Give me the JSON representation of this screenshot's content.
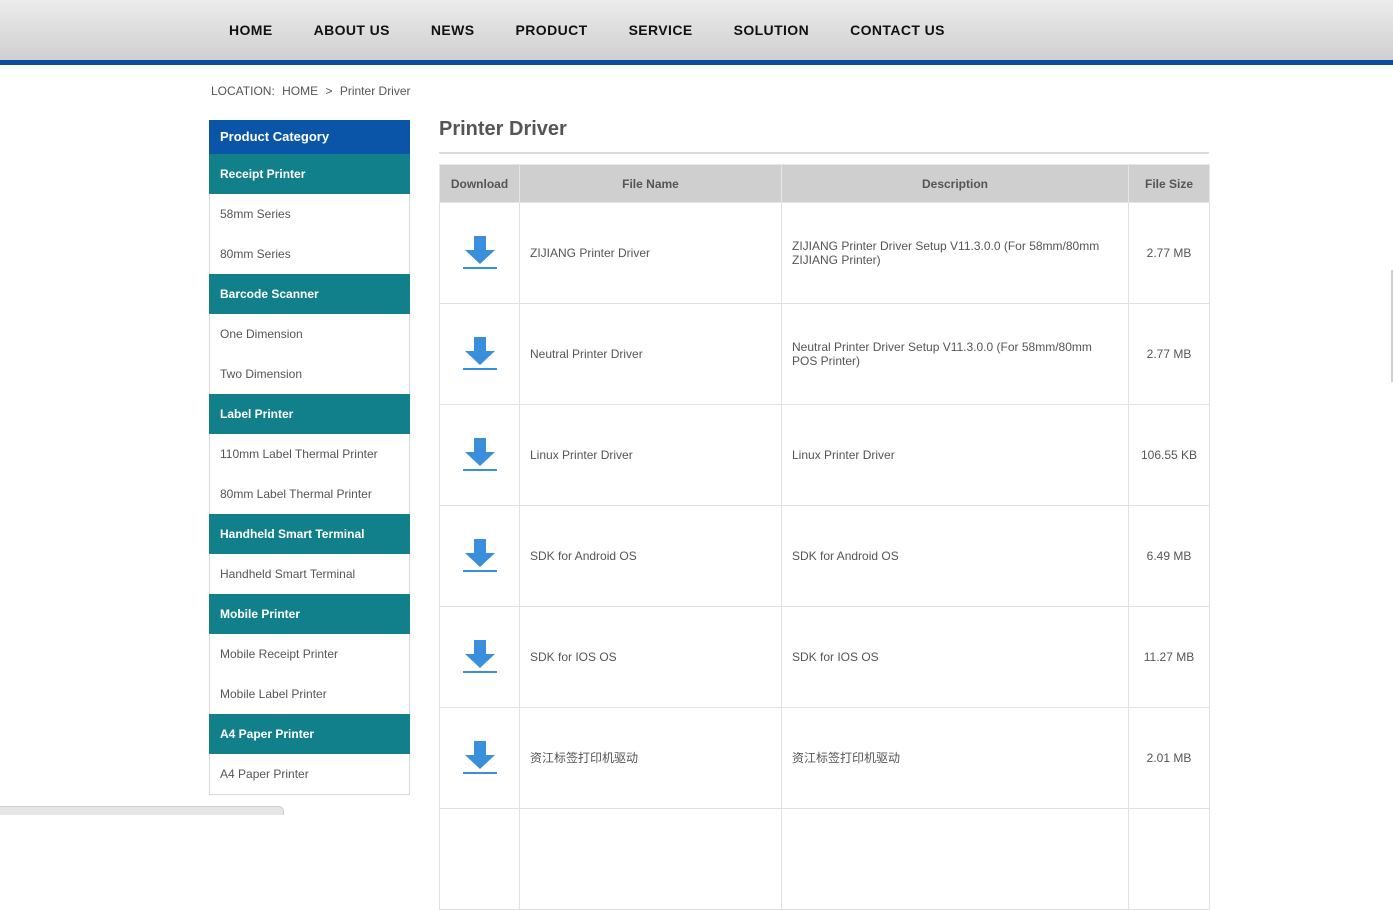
{
  "nav": {
    "items": [
      "HOME",
      "ABOUT US",
      "NEWS",
      "PRODUCT",
      "SERVICE",
      "SOLUTION",
      "CONTACT US"
    ]
  },
  "breadcrumb": {
    "label": "LOCATION:",
    "home": "HOME",
    "separator": ">",
    "current": "Printer Driver"
  },
  "sidebar": {
    "header": "Product Category",
    "groups": [
      {
        "label": "Receipt Printer",
        "items": [
          "58mm Series",
          "80mm Series"
        ]
      },
      {
        "label": "Barcode Scanner",
        "items": [
          "One Dimension",
          "Two Dimension"
        ]
      },
      {
        "label": "Label Printer",
        "items": [
          "110mm Label Thermal Printer",
          "80mm Label Thermal Printer"
        ]
      },
      {
        "label": "Handheld Smart Terminal",
        "items": [
          "Handheld Smart Terminal"
        ]
      },
      {
        "label": "Mobile Printer",
        "items": [
          "Mobile Receipt Printer",
          "Mobile Label Printer"
        ]
      },
      {
        "label": "A4 Paper Printer",
        "items": [
          "A4 Paper Printer"
        ]
      }
    ]
  },
  "main": {
    "title": "Printer Driver",
    "table": {
      "headers": [
        "Download",
        "File Name",
        "Description",
        "File Size"
      ],
      "rows": [
        {
          "name": "ZIJIANG Printer Driver",
          "description": "ZIJIANG Printer Driver Setup V11.3.0.0 (For 58mm/80mm ZIJIANG Printer)",
          "size": "2.77 MB"
        },
        {
          "name": "Neutral Printer Driver",
          "description": "Neutral Printer Driver Setup V11.3.0.0 (For 58mm/80mm POS Printer)",
          "size": "2.77 MB"
        },
        {
          "name": "Linux Printer Driver",
          "description": "Linux Printer Driver",
          "size": "106.55 KB"
        },
        {
          "name": "SDK for Android OS",
          "description": "SDK for Android OS",
          "size": "6.49 MB"
        },
        {
          "name": "SDK for IOS OS",
          "description": "SDK for IOS OS",
          "size": "11.27 MB"
        },
        {
          "name": "资江标签打印机驱动",
          "description": "资江标签打印机驱动",
          "size": "2.01 MB"
        },
        {
          "name": "",
          "description": "",
          "size": ""
        }
      ]
    }
  },
  "icons": {
    "download": "download-arrow-icon"
  },
  "colors": {
    "nav_underline": "#0b4e9b",
    "sidebar_header": "#0a55a8",
    "sidebar_group": "#12808a",
    "download_icon": "#3a8fdc"
  }
}
